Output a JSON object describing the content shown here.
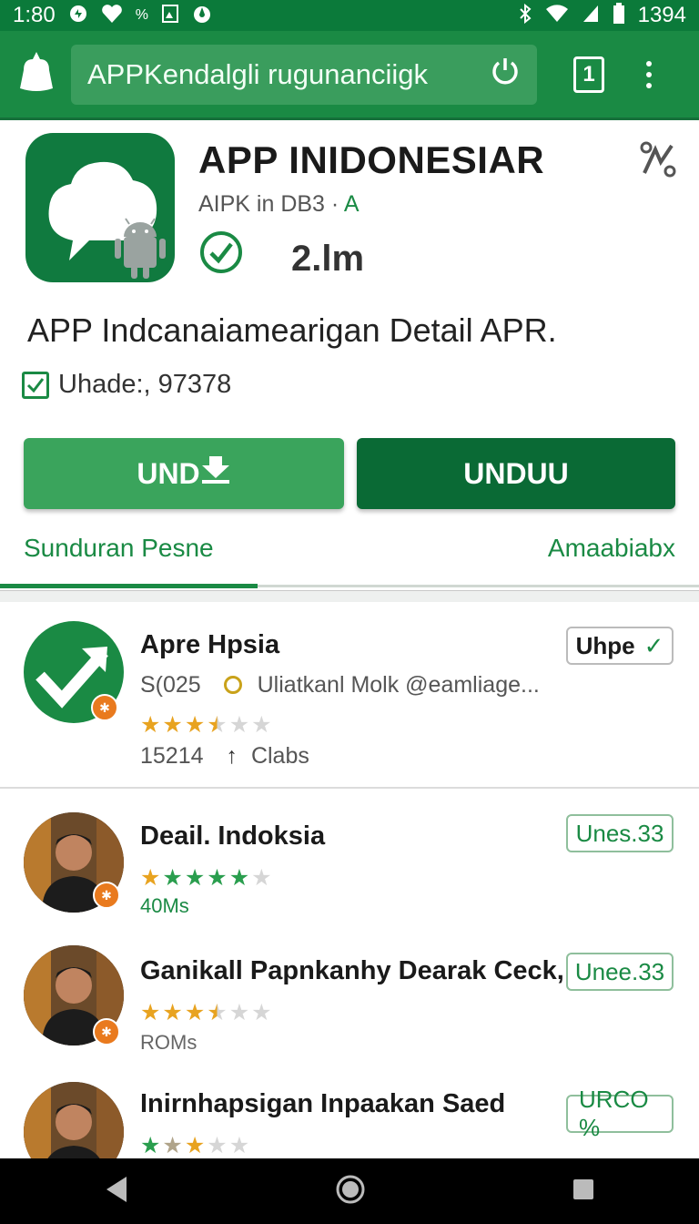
{
  "status_bar": {
    "time": "1:80",
    "right_value": "1394",
    "icons": [
      "sync-icon",
      "heart-icon",
      "percent-icon",
      "image-icon",
      "drop-icon",
      "bluetooth-icon",
      "wifi-icon",
      "signal-icon",
      "battery-icon"
    ]
  },
  "toolbar": {
    "url_text": "APPKendalgli rugunanciigk",
    "tabs_count": "1"
  },
  "app": {
    "title": "APP INIDONESIAR",
    "developer": "AIPK in DB3 ·",
    "developer_accent": "A",
    "rating": "2.lm",
    "description": "APP Indcanaiamearigan Detail APR.",
    "update_label": "Uhade:, 97378",
    "button_left": "UND",
    "button_right": "UNDUU",
    "tab_left": "Sunduran Pesne",
    "tab_right": "Amaabiabx"
  },
  "list": [
    {
      "title": "Apre Hpsia",
      "subtitle_left": "S(025",
      "subtitle_right": "Uliatkanl Molk @eamliage...",
      "pill": "Uhpe",
      "rating_fraction": 0.7,
      "meta_count": "15214",
      "meta_label": "Clabs"
    },
    {
      "title": "Deail. Indoksia",
      "pill": "Unes.33",
      "rating_fraction": 0.9,
      "meta": "40Ms"
    },
    {
      "title": "Ganikall Papnkanhy Dearak Ceck,",
      "pill": "Unee.33",
      "rating_fraction": 0.7,
      "meta": "ROMs"
    },
    {
      "title": "Inirnhapsigan Inpaakan Saed",
      "pill": "URCO %",
      "rating_fraction": 0.5
    }
  ],
  "colors": {
    "primary": "#1a8a44",
    "dark": "#0a6a35",
    "star": "#e8a320"
  }
}
